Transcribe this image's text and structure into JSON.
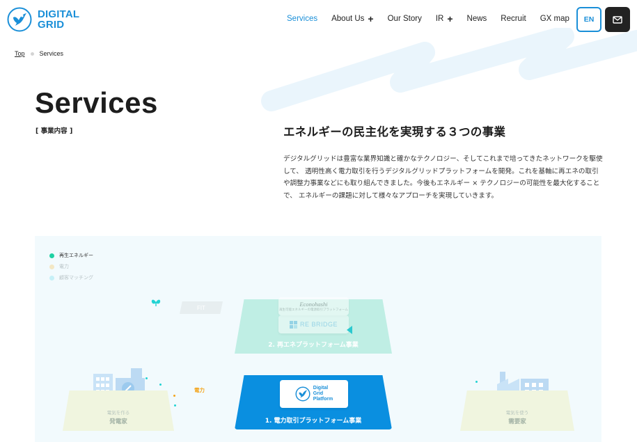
{
  "brand": {
    "line1": "DIGITAL",
    "line2": "GRID",
    "color": "#1a8fd8"
  },
  "nav": {
    "items": [
      {
        "label": "Services",
        "active": true,
        "expandable": false
      },
      {
        "label": "About Us",
        "active": false,
        "expandable": true
      },
      {
        "label": "Our Story",
        "active": false,
        "expandable": false
      },
      {
        "label": "IR",
        "active": false,
        "expandable": true
      },
      {
        "label": "News",
        "active": false,
        "expandable": false
      },
      {
        "label": "Recruit",
        "active": false,
        "expandable": false
      },
      {
        "label": "GX map",
        "active": false,
        "expandable": false
      }
    ],
    "plus_icon": "+",
    "lang_button": "EN",
    "mail_icon": "mail-icon"
  },
  "breadcrumb": {
    "home": "Top",
    "current": "Services"
  },
  "hero": {
    "title": "Services",
    "subtitle": "[ 事業内容 ]",
    "heading": "エネルギーの民主化を実現する３つの事業",
    "body": "デジタルグリッドは豊富な業界知識と確かなテクノロジー、そしてこれまで培ってきたネットワークを駆使して、 透明性高く電力取引を行うデジタルグリッドプラットフォームを開発。これを基軸に再エネの取引や調整力事業などにも取り組んできました。今後もエネルギー × テクノロジーの可能性を最大化することで、 エネルギーの課題に対して様々なアプローチを実現していきます。"
  },
  "diagram": {
    "legend": [
      {
        "label": "再生エネルギー",
        "color": "#1fd1a3"
      },
      {
        "label": "電力",
        "color": "#f3e7c4"
      },
      {
        "label": "顧客マッチング",
        "color": "#c6f0f7"
      }
    ],
    "platform1": {
      "label": "1. 電力取引プラットフォーム事業",
      "card_text": [
        "Digital",
        "Grid",
        "Platform"
      ]
    },
    "platform2": {
      "label": "2. 再エネプラットフォーム事業",
      "econohashi": "Econohashi",
      "econohashi_sub": "再生可能エネルギーの電源取引プラットフォーム",
      "rebridge": "RE BRIDGE"
    },
    "fit_tag": "FIT",
    "power_label": "電力",
    "left_ground": {
      "small": "電気を作る",
      "big": "発電家"
    },
    "right_ground": {
      "small": "電気を使う",
      "big": "需要家"
    },
    "colors": {
      "platform1": "#0a8fe0",
      "platform2": "#bfeee4",
      "accent_orange": "#f3a41c",
      "accent_teal": "#2bc9cf"
    }
  }
}
